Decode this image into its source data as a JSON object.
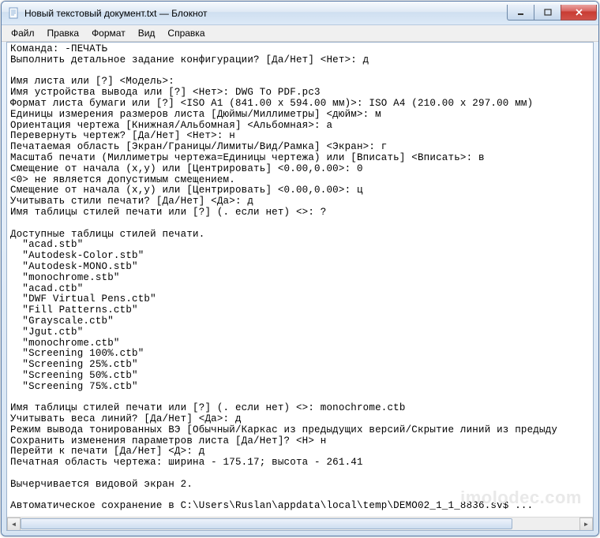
{
  "window": {
    "title": "Новый текстовый документ.txt — Блокнот"
  },
  "menu": {
    "file": "Файл",
    "edit": "Правка",
    "format": "Формат",
    "view": "Вид",
    "help": "Справка"
  },
  "content_text": "Команда: -ПЕЧАТЬ\nВыполнить детальное задание конфигурации? [Да/Нет] <Нет>: д\n\nИмя листа или [?] <Модель>:\nИмя устройства вывода или [?] <Нет>: DWG To PDF.pc3\nФормат листа бумаги или [?] <ISO A1 (841.00 x 594.00 мм)>: ISO A4 (210.00 x 297.00 мм)\nЕдиницы измерения размеров листа [Дюймы/Миллиметры] <дюйм>: м\nОриентация чертежа [Книжная/Альбомная] <Альбомная>: а\nПеревернуть чертеж? [Да/Нет] <Нет>: н\nПечатаемая область [Экран/Границы/Лимиты/Вид/Рамка] <Экран>: г\nМасштаб печати (Миллиметры чертежа=Единицы чертежа) или [Вписать] <Вписать>: в\nСмещение от начала (x,y) или [Центрировать] <0.00,0.00>: 0\n<0> не является допустимым смещением.\nСмещение от начала (x,y) или [Центрировать] <0.00,0.00>: ц\nУчитывать стили печати? [Да/Нет] <Да>: д\nИмя таблицы стилей печати или [?] (. если нет) <>: ?\n\nДоступные таблицы стилей печати.\n  \"acad.stb\"\n  \"Autodesk-Color.stb\"\n  \"Autodesk-MONO.stb\"\n  \"monochrome.stb\"\n  \"acad.ctb\"\n  \"DWF Virtual Pens.ctb\"\n  \"Fill Patterns.ctb\"\n  \"Grayscale.ctb\"\n  \"Jgut.ctb\"\n  \"monochrome.ctb\"\n  \"Screening 100%.ctb\"\n  \"Screening 25%.ctb\"\n  \"Screening 50%.ctb\"\n  \"Screening 75%.ctb\"\n\nИмя таблицы стилей печати или [?] (. если нет) <>: monochrome.ctb\nУчитывать веса линий? [Да/Нет] <Да>: д\nРежим вывода тонированных ВЭ [Обычный/Каркас из предыдущих версий/Скрытие линий из предыду\nСохранить изменения параметров листа [Да/Нет]? <Н> н\nПерейти к печати [Да/Нет] <Д>: д\nПечатная область чертежа: ширина - 175.17; высота - 261.41\n\nВычерчивается видовой экран 2.\n\nАвтоматическое сохранение в C:\\Users\\Ruslan\\appdata\\local\\temp\\DEMO02_1_1_8836.sv$ ...",
  "watermark": "imolodec.com"
}
